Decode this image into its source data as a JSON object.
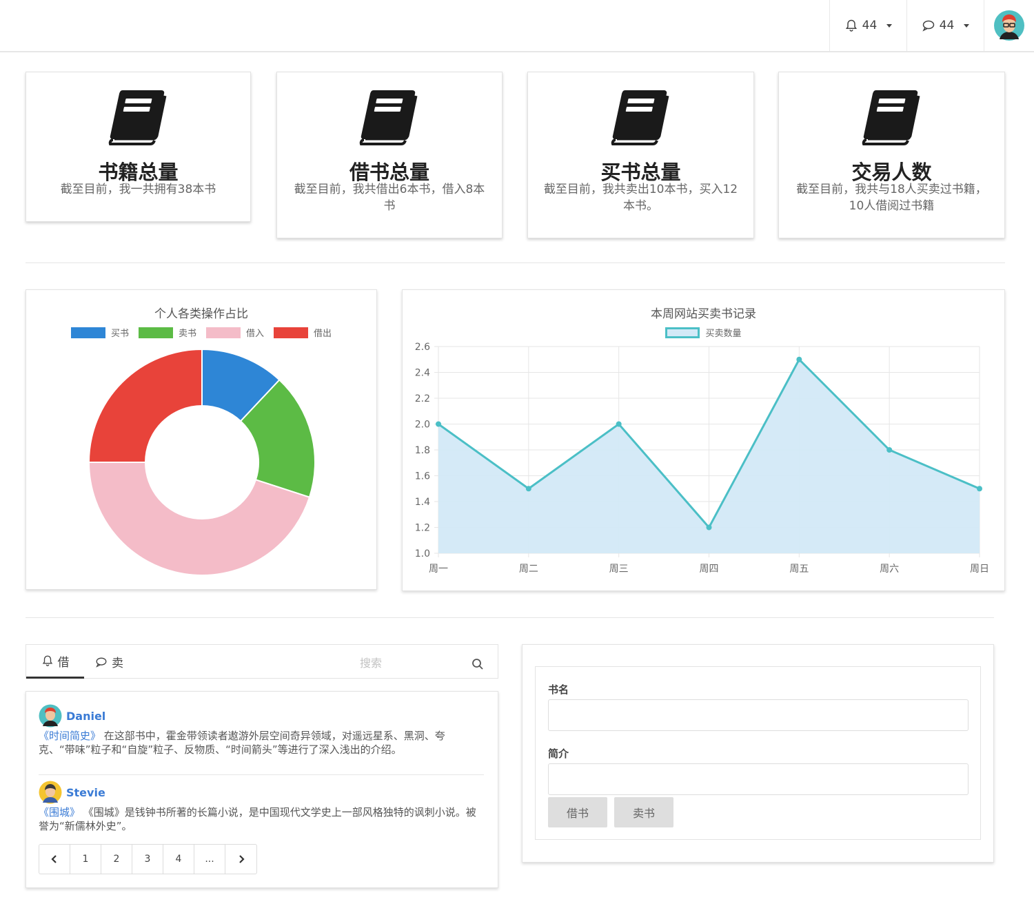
{
  "header": {
    "notifications": {
      "icon": "bell-icon",
      "count": "44"
    },
    "messages": {
      "icon": "chat-icon",
      "count": "44"
    },
    "avatar": "user-avatar"
  },
  "stats": [
    {
      "icon": "book-icon",
      "title": "书籍总量",
      "desc": "截至目前，我一共拥有38本书"
    },
    {
      "icon": "book-icon",
      "title": "借书总量",
      "desc": "截至目前，我共借出6本书，借入8本书"
    },
    {
      "icon": "book-icon",
      "title": "买书总量",
      "desc": "截至目前，我共卖出10本书，买入12本书。"
    },
    {
      "icon": "book-icon",
      "title": "交易人数",
      "desc": "截至目前，我共与18人买卖过书籍，10人借阅过书籍"
    }
  ],
  "chart_data": [
    {
      "type": "pie",
      "style": "doughnut",
      "title": "个人各类操作占比",
      "categories": [
        "买书",
        "卖书",
        "借入",
        "借出"
      ],
      "values": [
        12,
        18,
        45,
        25
      ],
      "colors": [
        "#2e86d6",
        "#5cbb45",
        "#f4bcc8",
        "#e8433a"
      ],
      "legend_position": "top"
    },
    {
      "type": "area",
      "title": "本周网站买卖书记录",
      "categories": [
        "周一",
        "周二",
        "周三",
        "周四",
        "周五",
        "周六",
        "周日"
      ],
      "series": [
        {
          "name": "买卖数量",
          "values": [
            2.0,
            1.5,
            2.0,
            1.2,
            2.5,
            1.8,
            1.5
          ]
        }
      ],
      "ylim": [
        1.0,
        2.6
      ],
      "yticks": [
        "2.6",
        "2.4",
        "2.2",
        "2.0",
        "1.8",
        "1.6",
        "1.4",
        "1.2",
        "1.0"
      ],
      "grid": true,
      "legend_position": "top",
      "line_color": "#4bbfc6",
      "fill_color": "#d3e9f7"
    }
  ],
  "tabs": [
    {
      "icon": "bell-icon",
      "label": "借"
    },
    {
      "icon": "chat-icon",
      "label": "卖"
    }
  ],
  "search": {
    "placeholder": "搜索"
  },
  "list": [
    {
      "name": "Daniel",
      "book": "《时间简史》",
      "text": " 在这部书中，霍金带领读者遨游外层空间奇异领域，对遥远星系、黑洞、夸克、“带味”粒子和“自旋”粒子、反物质、“时间箭头”等进行了深入浅出的介绍。"
    },
    {
      "name": "Stevie",
      "book": "《围城》",
      "text": " 《围城》是钱钟书所著的长篇小说，是中国现代文学史上一部风格独特的讽刺小说。被誉为“新儒林外史”。"
    }
  ],
  "pagination": [
    "1",
    "2",
    "3",
    "4",
    "..."
  ],
  "form": {
    "title_label": "书名",
    "intro_label": "简介",
    "borrow_button": "借书",
    "sell_button": "卖书"
  }
}
